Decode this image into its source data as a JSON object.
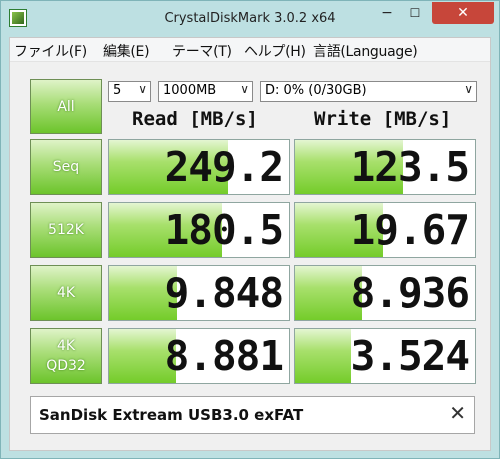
{
  "window": {
    "title": "CrystalDiskMark 3.0.2 x64",
    "minimize_glyph": "−",
    "maximize_glyph": "☐",
    "close_glyph": "✕"
  },
  "menu": [
    {
      "label": "ファイル(F)"
    },
    {
      "label": "編集(E)"
    },
    {
      "label": "テーマ(T)"
    },
    {
      "label": "ヘルプ(H)"
    },
    {
      "label": "言語(Language)"
    }
  ],
  "controls": {
    "all_button": "All",
    "count": {
      "value": "5",
      "options": [
        "5"
      ]
    },
    "size": {
      "value": "1000MB",
      "options": [
        "1000MB"
      ]
    },
    "drive": {
      "value": "D: 0% (0/30GB)",
      "options": [
        "D: 0% (0/30GB)"
      ]
    },
    "dropdown_glyph": "∨"
  },
  "headers": {
    "read": "Read [MB/s]",
    "write": "Write [MB/s]"
  },
  "tests": [
    {
      "label_line1": "Seq",
      "label_line2": "",
      "read": "249.2",
      "write": "123.5",
      "read_fill": 0.66,
      "write_fill": 0.6
    },
    {
      "label_line1": "512K",
      "label_line2": "",
      "read": "180.5",
      "write": "19.67",
      "read_fill": 0.63,
      "write_fill": 0.49
    },
    {
      "label_line1": "4K",
      "label_line2": "",
      "read": "9.848",
      "write": "8.936",
      "read_fill": 0.38,
      "write_fill": 0.37
    },
    {
      "label_line1": "4K",
      "label_line2": "QD32",
      "read": "8.881",
      "write": "3.524",
      "read_fill": 0.37,
      "write_fill": 0.31
    }
  ],
  "comment": {
    "value": "SanDisk Extream USB3.0 exFAT",
    "clear_glyph": "✕"
  },
  "colors": {
    "accent_green": "#6cc42b",
    "window_frame": "#bde0e2",
    "close_red": "#c7463a"
  }
}
